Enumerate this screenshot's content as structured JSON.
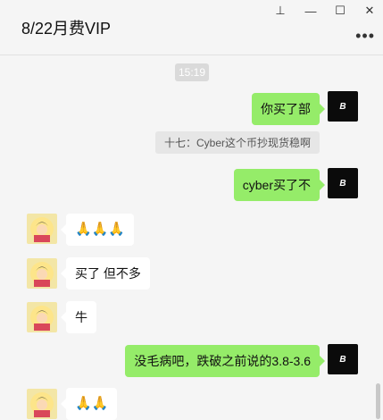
{
  "window": {
    "title": "8/22月费VIP",
    "pin_icon": "⊥",
    "minimize_icon": "—",
    "maximize_icon": "☐",
    "close_icon": "✕",
    "more_icon": "•••"
  },
  "chat": {
    "timestamp": "15:19",
    "quote": "十七：Cyber这个币抄现货稳啊",
    "self_avatar_text": "B",
    "messages": [
      {
        "side": "self",
        "text": "你买了部"
      },
      {
        "side": "self",
        "text": "cyber买了不"
      },
      {
        "side": "other",
        "text": "🙏🙏🙏"
      },
      {
        "side": "other",
        "text": "买了 但不多"
      },
      {
        "side": "other",
        "text": "牛"
      },
      {
        "side": "self",
        "text": "没毛病吧，跌破之前说的3.8-3.6"
      },
      {
        "side": "other",
        "text": "🙏🙏"
      }
    ]
  },
  "colors": {
    "self_bubble": "#95ec69",
    "other_bubble": "#ffffff",
    "background": "#f5f5f5"
  }
}
